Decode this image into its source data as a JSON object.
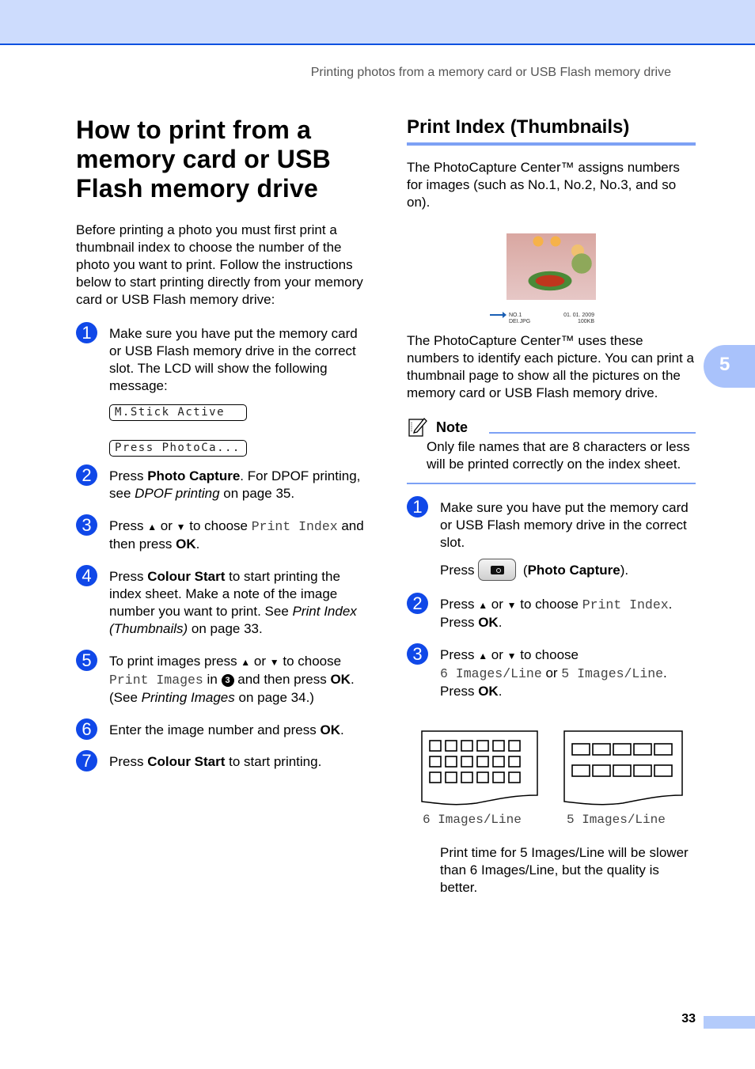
{
  "header": {
    "running_title": "Printing photos from a memory card or USB Flash memory drive"
  },
  "chapter_tab": "5",
  "footer": {
    "page_number": "33"
  },
  "left": {
    "title": "How to print from a memory card or USB Flash memory drive",
    "intro": "Before printing a photo you must first print a thumbnail index to choose the number of the photo you want to print. Follow the instructions below to start printing directly from your memory card or USB Flash memory drive:",
    "steps": [
      {
        "num": "1",
        "text": "Make sure you have put the memory card or USB Flash memory drive in the correct slot. The LCD will show the following message:",
        "lcd": [
          "M.Stick Active",
          "Press PhotoCa..."
        ]
      },
      {
        "num": "2",
        "a": "Press ",
        "b": "Photo Capture",
        "c": ". For DPOF printing, see ",
        "d": "DPOF printing",
        "e": " on page 35."
      },
      {
        "num": "3",
        "a": "Press ",
        "up": "▲",
        "or": " or ",
        "down": "▼",
        "b": " to choose ",
        "mono": "Print Index",
        "c": " and then press ",
        "ok": "OK",
        "d": "."
      },
      {
        "num": "4",
        "a": "Press ",
        "b": "Colour Start",
        "c": " to start printing the index sheet. Make a note of the image number you want to print. See ",
        "d": "Print Index (Thumbnails)",
        "e": " on page 33."
      },
      {
        "num": "5",
        "a": "To print images press ",
        "up": "▲",
        "or": " or ",
        "down": "▼",
        "b": " to choose ",
        "mono": "Print Images",
        "c": " in ",
        "ref": "3",
        "d": " and then press ",
        "ok": "OK",
        "e": ". (See ",
        "f": "Printing Images",
        "g": " on page 34.)"
      },
      {
        "num": "6",
        "a": "Enter the image number and press ",
        "ok": "OK",
        "b": "."
      },
      {
        "num": "7",
        "a": "Press ",
        "b": "Colour Start",
        "c": " to start printing."
      }
    ]
  },
  "right": {
    "heading": "Print Index (Thumbnails)",
    "para1": "The PhotoCapture Center™ assigns numbers for images (such as No.1, No.2, No.3, and so on).",
    "photo_caption": {
      "number": "NO.1",
      "filename": "DEI.JPG",
      "date": "01. 01. 2009",
      "size": "100KB"
    },
    "para2": "The PhotoCapture Center™ uses these numbers to identify each picture. You can print a thumbnail page to show all the pictures on the memory card or USB Flash memory drive.",
    "note": {
      "title": "Note",
      "text": "Only file names that are 8 characters or less will be printed correctly on the index sheet."
    },
    "steps": [
      {
        "num": "1",
        "text": "Make sure you have put the memory card or USB Flash memory drive in the correct slot.",
        "press": "Press ",
        "paren_open": " (",
        "button_label": "Photo Capture",
        "paren_close": ")."
      },
      {
        "num": "2",
        "a": "Press ",
        "up": "▲",
        "or": " or ",
        "down": "▼",
        "b": " to choose ",
        "mono": "Print Index",
        "c": ".",
        "d": "Press ",
        "ok": "OK",
        "e": "."
      },
      {
        "num": "3",
        "a": "Press ",
        "up": "▲",
        "or": " or ",
        "down": "▼",
        "b": " to choose",
        "mono1": "6 Images/Line",
        "or2": " or ",
        "mono2": "5 Images/Line",
        "c": ".",
        "d": "Press ",
        "ok": "OK",
        "e": "."
      }
    ],
    "figures": [
      {
        "label": "6 Images/Line",
        "cols": 6,
        "rows": 3
      },
      {
        "label": "5 Images/Line",
        "cols": 5,
        "rows": 2
      }
    ],
    "closing": "Print time for 5 Images/Line will be slower than 6 Images/Line, but the quality is better."
  }
}
